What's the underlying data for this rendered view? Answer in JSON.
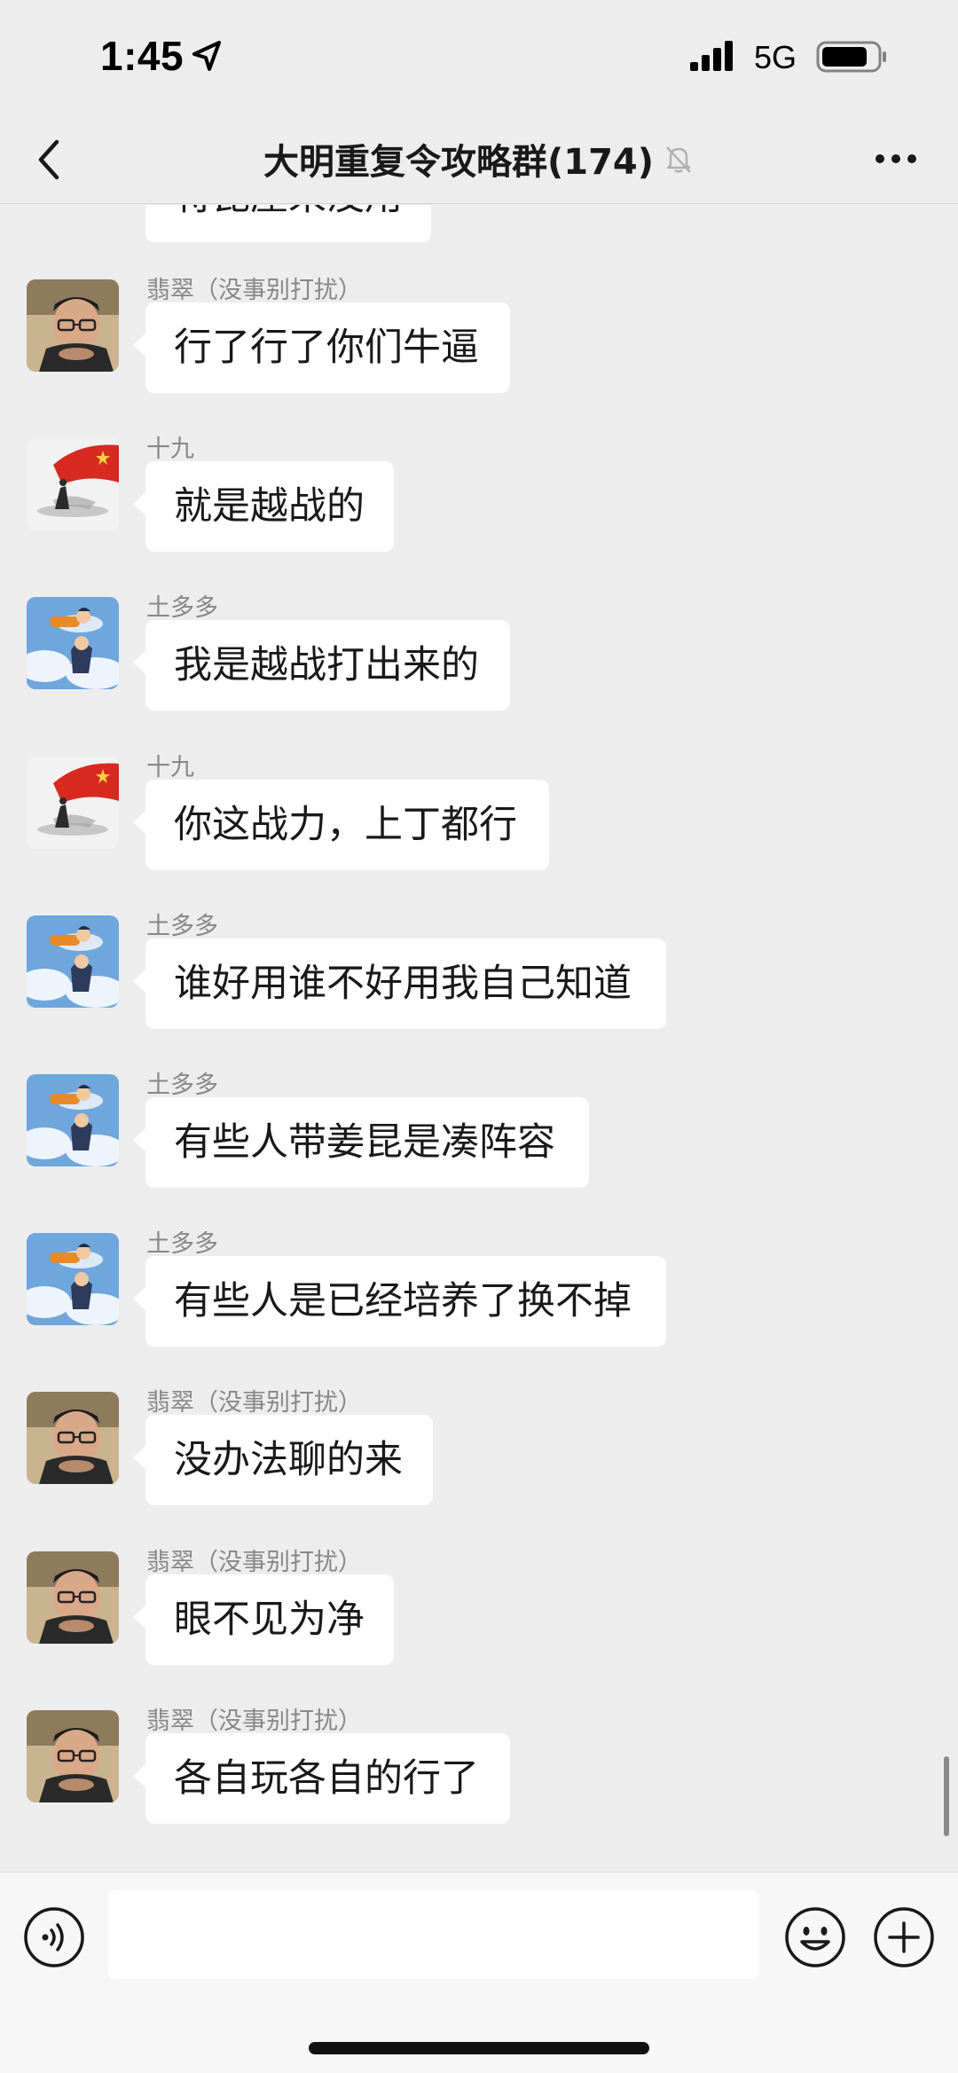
{
  "status_bar": {
    "time": "1:45",
    "network": "5G"
  },
  "nav": {
    "title": "大明重复令攻略群(174)"
  },
  "partial_message": {
    "text": "将昆屋来没用"
  },
  "messages": [
    {
      "sender": "翡翠（没事别打扰）",
      "avatar": "avatar-glasses-man",
      "text": "行了行了你们牛逼"
    },
    {
      "sender": "十九",
      "avatar": "avatar-red-flag",
      "text": "就是越战的"
    },
    {
      "sender": "土多多",
      "avatar": "avatar-cartoon-sky",
      "text": "我是越战打出来的"
    },
    {
      "sender": "十九",
      "avatar": "avatar-red-flag",
      "text": "你这战力，上丁都行"
    },
    {
      "sender": "土多多",
      "avatar": "avatar-cartoon-sky",
      "text": "谁好用谁不好用我自己知道"
    },
    {
      "sender": "土多多",
      "avatar": "avatar-cartoon-sky",
      "text": "有些人带姜昆是凑阵容"
    },
    {
      "sender": "土多多",
      "avatar": "avatar-cartoon-sky",
      "text": "有些人是已经培养了换不掉"
    },
    {
      "sender": "翡翠（没事别打扰）",
      "avatar": "avatar-glasses-man",
      "text": "没办法聊的来"
    },
    {
      "sender": "翡翠（没事别打扰）",
      "avatar": "avatar-glasses-man",
      "text": "眼不见为净"
    },
    {
      "sender": "翡翠（没事别打扰）",
      "avatar": "avatar-glasses-man",
      "text": "各自玩各自的行了"
    }
  ],
  "input": {
    "placeholder": "",
    "value": ""
  },
  "icons": {
    "back": "chevron-left-icon",
    "mute": "bell-off-icon",
    "more": "more-icon",
    "voice": "voice-icon",
    "emoji": "emoji-icon",
    "plus": "plus-icon"
  }
}
